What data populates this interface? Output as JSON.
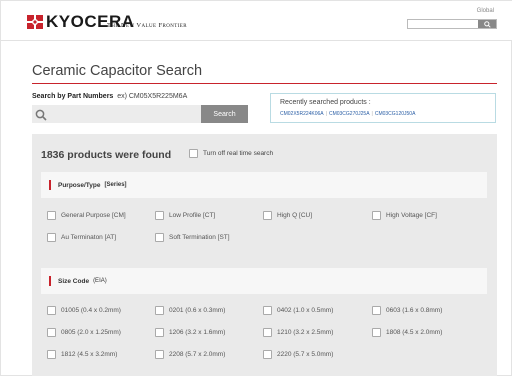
{
  "header": {
    "logo_text": "KYOCERA",
    "tagline": "The New Value Frontier",
    "global_label": "Global",
    "global_search_placeholder": ""
  },
  "page": {
    "title": "Ceramic Capacitor Search"
  },
  "part_search": {
    "label_bold": "Search by Part Numbers",
    "label_example": "ex) CM05X5R225M6A",
    "input_value": "",
    "button_label": "Search"
  },
  "recent": {
    "title": "Recently searched products :",
    "items": [
      "CM02X5R224K06A",
      "CM03CG270J25A",
      "CM03CG120J50A"
    ]
  },
  "results": {
    "count_text": "1836 products were found",
    "realtime_label": "Turn off real time search"
  },
  "groups": [
    {
      "title": "Purpose/Type",
      "subtitle": "[Series]",
      "options": [
        "General Purpose [CM]",
        "Low Profile [CT]",
        "High Q [CU]",
        "High Voltage [CF]",
        "Au Terminaton [AT]",
        "Soft Termination [ST]"
      ]
    },
    {
      "title": "Size Code",
      "subtitle": "(EIA)",
      "options": [
        "01005 (0.4 x 0.2mm)",
        "0201 (0.6 x 0.3mm)",
        "0402 (1.0 x 0.5mm)",
        "0603 (1.6 x 0.8mm)",
        "0805 (2.0 x 1.25mm)",
        "1206 (3.2 x 1.6mm)",
        "1210 (3.2 x 2.5mm)",
        "1808 (4.5 x 2.0mm)",
        "1812 (4.5 x 3.2mm)",
        "2208 (5.7 x 2.0mm)",
        "2220 (5.7 x 5.0mm)"
      ]
    }
  ],
  "colors": {
    "accent_red": "#c8232c",
    "panel_bg": "#eaeaea",
    "button_gray": "#888888",
    "link_blue": "#2a5ea5"
  }
}
